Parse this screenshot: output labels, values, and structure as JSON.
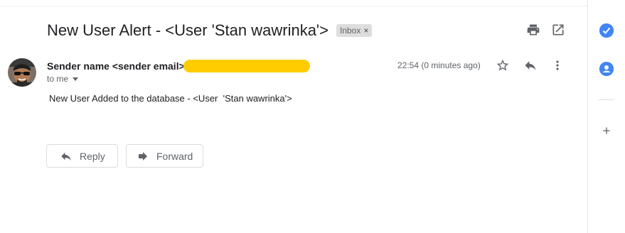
{
  "email": {
    "subject": "New User Alert - <User 'Stan wawrinka'>",
    "label": "Inbox",
    "label_close": "×",
    "sender": "Sender name <sender email>",
    "recipient": "to me",
    "timestamp": "22:54 (0 minutes ago)",
    "body": "New User Added to the database - <User  'Stan wawrinka'>"
  },
  "actions": {
    "reply_label": "Reply",
    "forward_label": "Forward"
  },
  "icons": {
    "print": "print-icon",
    "open_new_window": "open-in-new-icon",
    "star": "star-icon",
    "reply": "reply-icon",
    "more": "more-vert-icon",
    "tasks": "tasks-icon",
    "contacts": "contacts-icon",
    "add": "plus-icon"
  },
  "colors": {
    "redaction": "#ffcc00",
    "side_accent": "#4285f4"
  }
}
